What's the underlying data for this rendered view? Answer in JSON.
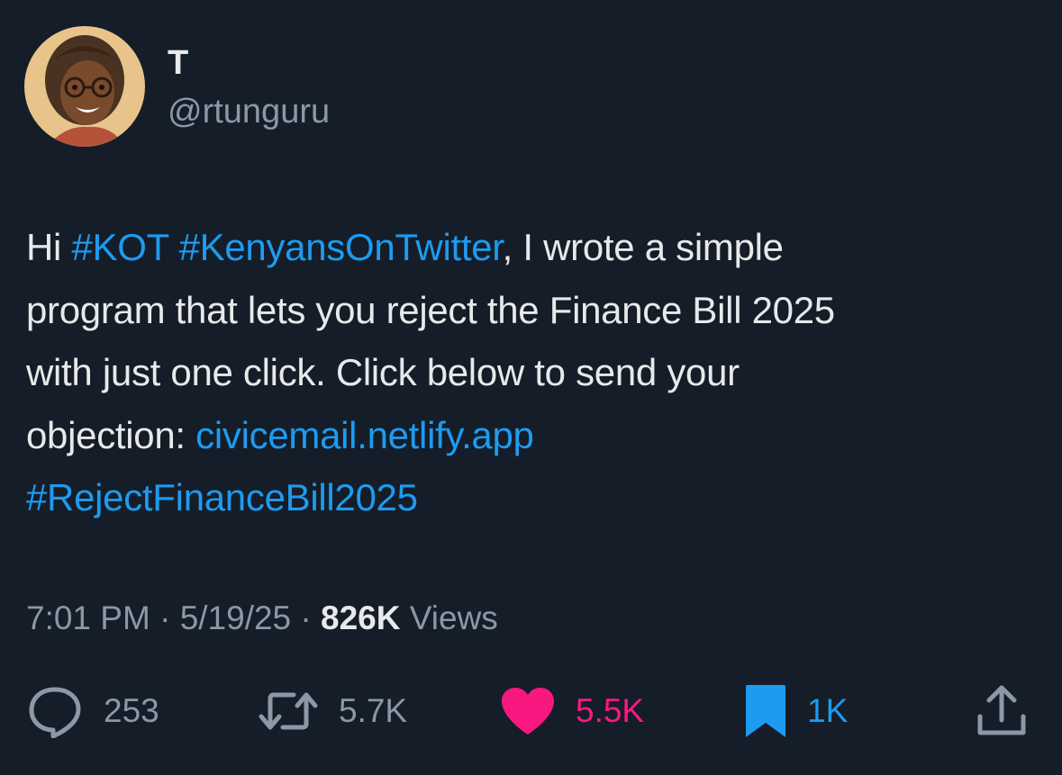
{
  "author": {
    "display_name": "T",
    "handle": "@rtunguru"
  },
  "tweet": {
    "lines": [
      [
        {
          "text": "Hi ",
          "link": false
        },
        {
          "text": "#KOT",
          "link": true
        },
        {
          "text": " ",
          "link": false
        },
        {
          "text": "#KenyansOnTwitter",
          "link": true
        },
        {
          "text": ", I wrote a simple",
          "link": false
        }
      ],
      [
        {
          "text": "program that lets you reject the Finance Bill 2025",
          "link": false
        }
      ],
      [
        {
          "text": "with just one click. Click below to send your",
          "link": false
        }
      ],
      [
        {
          "text": "objection: ",
          "link": false
        },
        {
          "text": "civicemail.netlify.app",
          "link": true
        }
      ],
      [
        {
          "text": "#RejectFinanceBill2025",
          "link": true
        }
      ]
    ]
  },
  "meta": {
    "time": "7:01 PM",
    "separator": " · ",
    "date": "5/19/25",
    "views_count": "826K",
    "views_label": " Views"
  },
  "actions": {
    "reply": {
      "icon": "reply-icon",
      "count": "253"
    },
    "retweet": {
      "icon": "retweet-icon",
      "count": "5.7K"
    },
    "like": {
      "icon": "heart-icon",
      "count": "5.5K",
      "active": true,
      "color": "#f91880"
    },
    "bookmark": {
      "icon": "bookmark-icon",
      "count": "1K",
      "active": true,
      "color": "#1d9bf0"
    },
    "share": {
      "icon": "share-icon"
    }
  },
  "colors": {
    "background": "#151d28",
    "text": "#e7e9ea",
    "secondary": "#8b98a5",
    "link": "#1d9bf0",
    "like": "#f91880",
    "bookmark": "#1d9bf0"
  }
}
